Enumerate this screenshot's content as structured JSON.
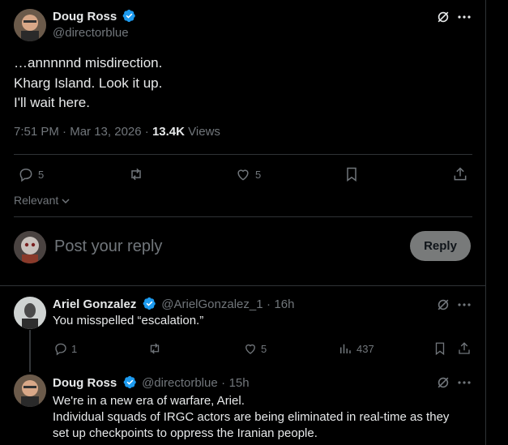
{
  "main_post": {
    "author_name": "Doug Ross",
    "author_handle": "@directorblue",
    "text_lines": [
      "…annnnnd misdirection.",
      "Kharg Island. Look it up.",
      "I'll wait here."
    ],
    "time": "7:51 PM",
    "separator": "·",
    "date": "Mar 13, 2026",
    "views_count": "13.4K",
    "views_label": "Views",
    "reply_count": "5",
    "like_count": "5",
    "icons": [
      "grok-icon",
      "more-icon",
      "reply-icon",
      "repost-icon",
      "like-icon",
      "bookmark-icon",
      "share-icon"
    ]
  },
  "sort": {
    "label": "Relevant"
  },
  "composer": {
    "placeholder": "Post your reply",
    "button_label": "Reply"
  },
  "replies": [
    {
      "author_name": "Ariel Gonzalez",
      "author_handle": "@ArielGonzalez_1",
      "separator": "·",
      "time": "16h",
      "text_lines": [
        "You misspelled “escalation.”"
      ],
      "reply_count": "1",
      "repost_count": "",
      "like_count": "5",
      "views_count": "437"
    },
    {
      "author_name": "Doug Ross",
      "author_handle": "@directorblue",
      "separator": "·",
      "time": "15h",
      "text_lines": [
        "We're in a new era of warfare, Ariel.",
        "Individual squads of IRGC actors are being eliminated in real-time as they",
        "set up checkpoints to oppress the Iranian people."
      ]
    }
  ],
  "colors": {
    "background": "#000000",
    "text": "#e7e9ea",
    "muted": "#71767b",
    "divider": "#2f3336",
    "verified": "#1d9bf0",
    "reply_button": "#787a7a"
  }
}
